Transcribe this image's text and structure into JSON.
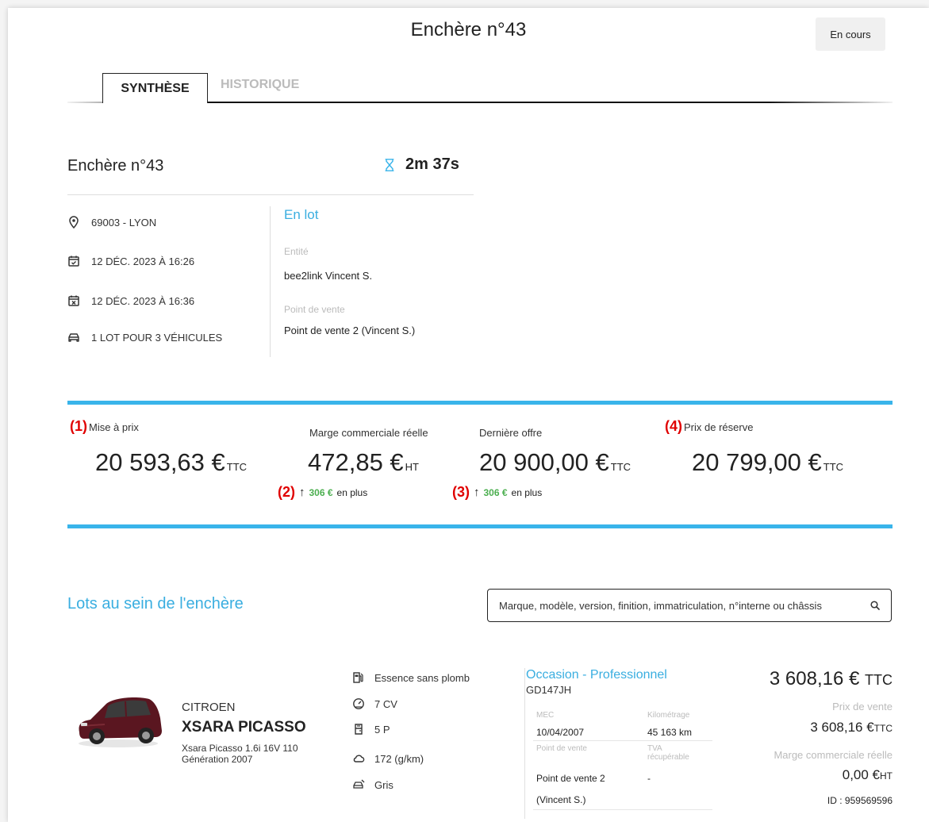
{
  "header": {
    "title": "Enchère n°43",
    "status": "En cours"
  },
  "tabs": [
    {
      "label": "SYNTHÈSE"
    },
    {
      "label": "HISTORIQUE"
    }
  ],
  "summary": {
    "title": "Enchère n°43",
    "timer": "2m 37s",
    "location": "69003 - LYON",
    "start": "12 DÉC. 2023 À 16:26",
    "end": "12 DÉC. 2023 À 16:36",
    "lots": "1 LOT POUR 3 VÉHICULES",
    "lot_kind": "En lot",
    "entity_label": "Entité",
    "entity_value": "bee2link Vincent S.",
    "pos_label": "Point de vente",
    "pos_value": "Point de vente 2 (Vincent S.)"
  },
  "kpis": [
    {
      "marker": "(1)",
      "label": "Mise à prix",
      "value": "20 593,63 €",
      "unit": "TTC"
    },
    {
      "label": "Marge commerciale réelle",
      "value": "472,85 €",
      "unit": "HT",
      "sub_marker": "(2)",
      "delta": "306 €",
      "delta_suffix": "en plus"
    },
    {
      "label": "Dernière offre",
      "value": "20 900,00 €",
      "unit": "TTC",
      "sub_marker": "(3)",
      "delta": "306 €",
      "delta_suffix": "en plus"
    },
    {
      "marker": "(4)",
      "label": "Prix de réserve",
      "value": "20 799,00 €",
      "unit": "TTC"
    }
  ],
  "lots_section": {
    "title": "Lots au sein de l'enchère",
    "search_placeholder": "Marque, modèle, version, finition, immatriculation, n°interne ou châssis"
  },
  "vehicle": {
    "make": "CITROEN",
    "model": "XSARA PICASSO",
    "version_line1": "Xsara Picasso 1.6i 16V 110",
    "version_line2": "Génération 2007",
    "fuel": "Essence sans plomb",
    "power": "7 CV",
    "doors": "5 P",
    "co2": "172 (g/km)",
    "color": "Gris",
    "offer_type": "Occasion - Professionnel",
    "plate": "GD147JH",
    "mec_label": "MEC",
    "mec_value": "10/04/2007",
    "km_label": "Kilométrage",
    "km_value": "45 163 km",
    "pos_label": "Point de vente",
    "pos_value_1": "Point de vente 2",
    "pos_value_2": "(Vincent S.)",
    "tva_label_1": "TVA",
    "tva_label_2": "récupérable",
    "tva_value": "-",
    "price_top": "3 608,16 €",
    "price_top_unit": "TTC",
    "sale_label": "Prix de vente",
    "sale_value": "3 608,16 €",
    "sale_unit": "TTC",
    "margin_label": "Marge commerciale réelle",
    "margin_value": "0,00 €",
    "margin_unit": "HT",
    "id": "ID : 959569596"
  },
  "colors": {
    "accent": "#39b4ea",
    "positive": "#4caf50",
    "marker": "#e00000"
  }
}
